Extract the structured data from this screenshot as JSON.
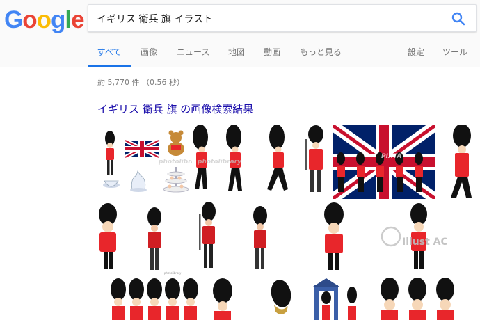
{
  "logo": {
    "letters": [
      "G",
      "o",
      "o",
      "g",
      "l",
      "e"
    ],
    "colors": [
      "#4285f4",
      "#ea4335",
      "#fbbc05",
      "#4285f4",
      "#34a853",
      "#ea4335"
    ]
  },
  "search": {
    "query": "イギリス 衛兵 旗 イラスト",
    "icon": "search-icon"
  },
  "tabs": [
    {
      "label": "すべて",
      "active": true
    },
    {
      "label": "画像",
      "active": false
    },
    {
      "label": "ニュース",
      "active": false
    },
    {
      "label": "地図",
      "active": false
    },
    {
      "label": "動画",
      "active": false
    },
    {
      "label": "もっと見る",
      "active": false
    },
    {
      "label": "設定",
      "active": false
    },
    {
      "label": "ツール",
      "active": false
    }
  ],
  "results_info": "約 5,770 件 （0.56 秒）",
  "image_heading": "イギリス 衛兵 旗 の画像検索結果",
  "watermarks": {
    "photolibrary": "photolibrary",
    "pixta": "PIXTA",
    "illust_ac": "Illust AC"
  },
  "colors": {
    "accent": "#1a73e8",
    "link": "#1a0dab",
    "guard_red": "#e8262b",
    "bearskin": "#111111"
  }
}
